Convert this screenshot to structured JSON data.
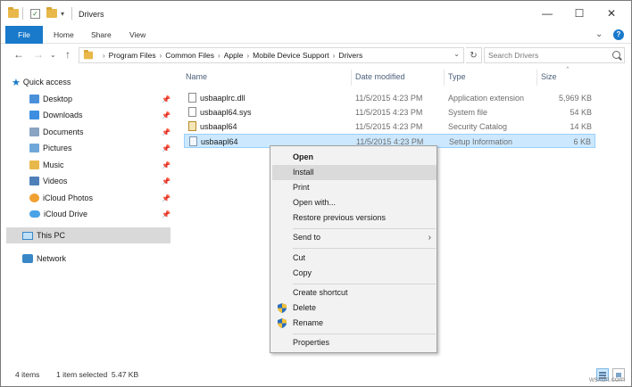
{
  "window": {
    "title": "Drivers"
  },
  "title_controls": {
    "minimize": "—",
    "maximize": "☐",
    "close": "✕"
  },
  "ribbon": {
    "tabs": [
      "File",
      "Home",
      "Share",
      "View"
    ],
    "collapse_icon": "chevron-down-icon",
    "help": "?"
  },
  "address": {
    "breadcrumb": [
      "Program Files",
      "Common Files",
      "Apple",
      "Mobile Device Support",
      "Drivers"
    ],
    "search_placeholder": "Search Drivers"
  },
  "sidebar": {
    "quick_access": "Quick access",
    "items": [
      {
        "label": "Desktop",
        "icon": "desktop-folder-icon",
        "color": "#4a90d9"
      },
      {
        "label": "Downloads",
        "icon": "downloads-folder-icon",
        "color": "#3d8ee0"
      },
      {
        "label": "Documents",
        "icon": "documents-folder-icon",
        "color": "#8aa4c2"
      },
      {
        "label": "Pictures",
        "icon": "pictures-folder-icon",
        "color": "#6fa7d8"
      },
      {
        "label": "Music",
        "icon": "music-folder-icon",
        "color": "#e8b84a"
      },
      {
        "label": "Videos",
        "icon": "videos-folder-icon",
        "color": "#4f7fb8"
      },
      {
        "label": "iCloud Photos",
        "icon": "icloud-photos-icon",
        "color": "#f0a030"
      },
      {
        "label": "iCloud Drive",
        "icon": "icloud-drive-icon",
        "color": "#4aa3e6"
      }
    ],
    "this_pc": "This PC",
    "network": "Network"
  },
  "columns": {
    "name": "Name",
    "date": "Date modified",
    "type": "Type",
    "size": "Size"
  },
  "files": [
    {
      "name": "usbaaplrc.dll",
      "date": "11/5/2015 4:23 PM",
      "type": "Application extension",
      "size": "5,969 KB",
      "icon": "dll-file-icon"
    },
    {
      "name": "usbaapl64.sys",
      "date": "11/5/2015 4:23 PM",
      "type": "System file",
      "size": "54 KB",
      "icon": "sys-file-icon"
    },
    {
      "name": "usbaapl64",
      "date": "11/5/2015 4:23 PM",
      "type": "Security Catalog",
      "size": "14 KB",
      "icon": "catalog-file-icon"
    },
    {
      "name": "usbaapl64",
      "date": "11/5/2015 4:23 PM",
      "type": "Setup Information",
      "size": "6 KB",
      "icon": "inf-file-icon"
    }
  ],
  "context_menu": {
    "open": "Open",
    "install": "Install",
    "print": "Print",
    "open_with": "Open with...",
    "restore": "Restore previous versions",
    "send_to": "Send to",
    "cut": "Cut",
    "copy": "Copy",
    "create_shortcut": "Create shortcut",
    "delete": "Delete",
    "rename": "Rename",
    "properties": "Properties"
  },
  "status": {
    "items": "4 items",
    "selected": "1 item selected  5.47 KB"
  },
  "watermark": "wsxdn.com",
  "colors": {
    "accent": "#1979ca",
    "selection": "#cce8ff",
    "menu_bg": "#f2f2f2"
  }
}
